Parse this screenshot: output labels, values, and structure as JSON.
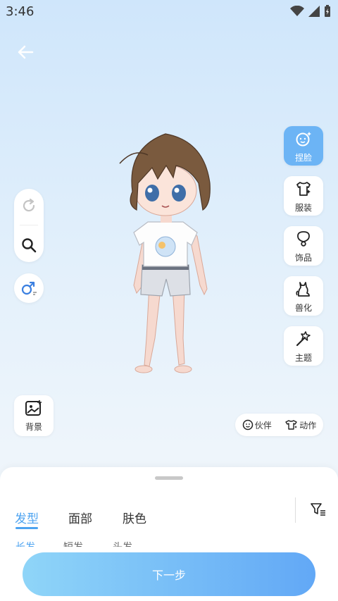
{
  "status_bar": {
    "time": "3:46"
  },
  "left_tools": {
    "background_label": "背景"
  },
  "right_tools": [
    {
      "label": "捏脸",
      "active": true
    },
    {
      "label": "服装",
      "active": false
    },
    {
      "label": "饰品",
      "active": false
    },
    {
      "label": "兽化",
      "active": false
    },
    {
      "label": "主题",
      "active": false
    }
  ],
  "bottom_pill": {
    "partner_label": "伙伴",
    "action_label": "动作"
  },
  "tabs": [
    {
      "label": "发型",
      "active": true
    },
    {
      "label": "面部",
      "active": false
    },
    {
      "label": "肤色",
      "active": false
    }
  ],
  "subtabs": [
    "长发",
    "短发",
    "头发"
  ],
  "next_button": {
    "label": "下一步"
  },
  "colors": {
    "accent": "#4da3f0",
    "active_tool": "#6cb4f5"
  }
}
